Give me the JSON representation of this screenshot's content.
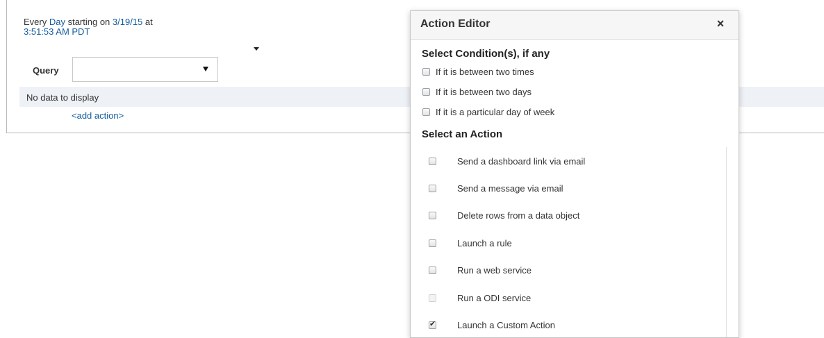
{
  "schedule": {
    "prefix": "Every ",
    "frequency": "Day",
    "middle": " starting on ",
    "date": "3/19/15",
    "suffix": " at",
    "time": "3:51:53 AM PDT"
  },
  "query": {
    "label": "Query",
    "value": ""
  },
  "table": {
    "empty_message": "No data to display"
  },
  "add_action_label": "<add action>",
  "dialog": {
    "title": "Action Editor",
    "close_label": "×",
    "conditions_title": "Select Condition(s), if any",
    "conditions": [
      {
        "label": "If it is between two times",
        "checked": false
      },
      {
        "label": "If it is between two days",
        "checked": false
      },
      {
        "label": "If it is a particular day of week",
        "checked": false
      }
    ],
    "actions_title": "Select an Action",
    "actions": [
      {
        "label": "Send a dashboard link via email",
        "checked": false,
        "disabled": false
      },
      {
        "label": "Send a message via email",
        "checked": false,
        "disabled": false
      },
      {
        "label": "Delete rows from a data object",
        "checked": false,
        "disabled": false
      },
      {
        "label": "Launch a rule",
        "checked": false,
        "disabled": false
      },
      {
        "label": "Run a web service",
        "checked": false,
        "disabled": false
      },
      {
        "label": "Run a ODI service",
        "checked": false,
        "disabled": true
      },
      {
        "label": "Launch a Custom Action",
        "checked": true,
        "disabled": false
      }
    ]
  }
}
